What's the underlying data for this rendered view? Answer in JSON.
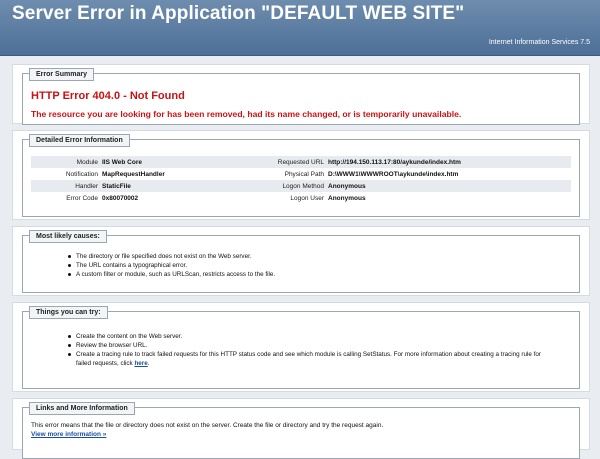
{
  "header": {
    "title": "Server Error in Application \"DEFAULT WEB SITE\"",
    "subtitle": "Internet Information Services 7.5"
  },
  "summary": {
    "legend": "Error Summary",
    "error_title": "HTTP Error 404.0 - Not Found",
    "error_message": "The resource you are looking for has been removed, had its name changed, or is temporarily unavailable."
  },
  "details": {
    "legend": "Detailed Error Information",
    "rows": [
      {
        "l_label": "Module",
        "l_value": "IIS Web Core",
        "r_label": "Requested URL",
        "r_value": "http://194.150.113.17:80/aykunde/index.htm"
      },
      {
        "l_label": "Notification",
        "l_value": "MapRequestHandler",
        "r_label": "Physical Path",
        "r_value": "D:\\WWW1\\WWWROOT\\aykunde\\index.htm"
      },
      {
        "l_label": "Handler",
        "l_value": "StaticFile",
        "r_label": "Logon Method",
        "r_value": "Anonymous"
      },
      {
        "l_label": "Error Code",
        "l_value": "0x80070002",
        "r_label": "Logon User",
        "r_value": "Anonymous"
      }
    ]
  },
  "causes": {
    "legend": "Most likely causes:",
    "items": [
      "The directory or file specified does not exist on the Web server.",
      "The URL contains a typographical error.",
      "A custom filter or module, such as URLScan, restricts access to the file."
    ]
  },
  "try": {
    "legend": "Things you can try:",
    "items": [
      "Create the content on the Web server.",
      "Review the browser URL.",
      "Create a tracing rule to track failed requests for this HTTP status code and see which module is calling SetStatus. For more information about creating a tracing rule for failed requests, click"
    ],
    "here_link": "here",
    "period": "."
  },
  "links": {
    "legend": "Links and More Information",
    "text": "This error means that the file or directory does not exist on the server. Create the file or directory and try the request again.",
    "more_link": "View more information »"
  }
}
